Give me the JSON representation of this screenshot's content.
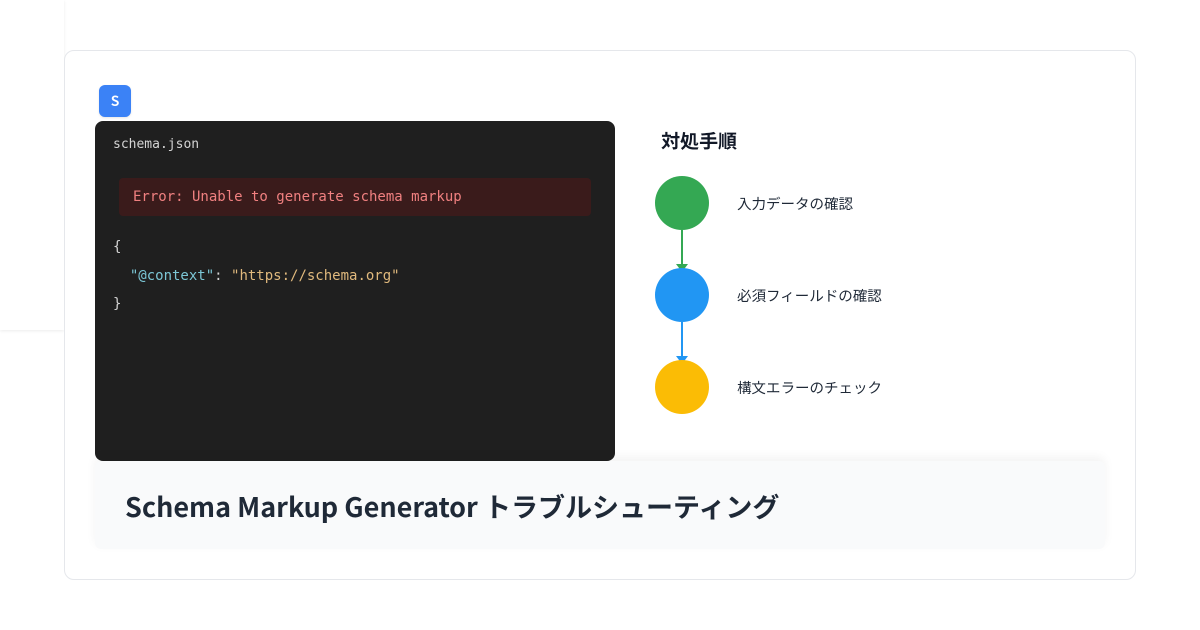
{
  "badge": "S",
  "code": {
    "filename": "schema.json",
    "error": "Error: Unable to generate schema markup",
    "brace_open": "{",
    "indent": "  ",
    "key_quoted": "\"@context\"",
    "colon_space": ": ",
    "value_quoted": "\"https://schema.org\"",
    "brace_close": "}"
  },
  "steps": {
    "title": "対処手順",
    "items": [
      {
        "label": "入力データの確認"
      },
      {
        "label": "必須フィールドの確認"
      },
      {
        "label": "構文エラーのチェック"
      }
    ]
  },
  "footer": {
    "title": "Schema Markup Generator トラブルシューティング"
  }
}
